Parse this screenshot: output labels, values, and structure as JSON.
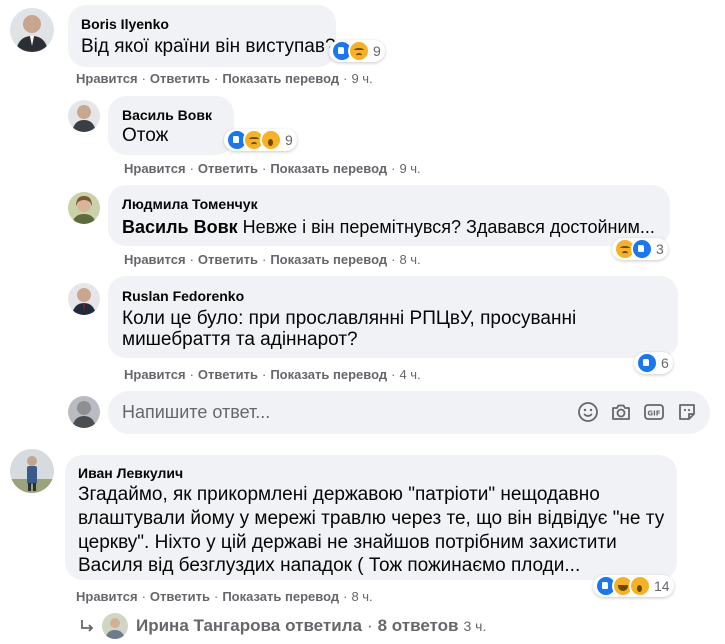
{
  "meta_actions": {
    "like": "Нравится",
    "reply": "Ответить",
    "translate": "Показать перевод",
    "dot": "·"
  },
  "comments": [
    {
      "author": "Boris Ilyenko",
      "text": "Від якої країни він виступав?",
      "count": "9",
      "time": "9 ч."
    },
    {
      "author": "Василь Вовк",
      "text": "Отож",
      "count": "9",
      "time": "9 ч."
    },
    {
      "author": "Людмила Томенчук",
      "mention": "Василь Вовк",
      "text": " Невже і він перемітнувся? Здавався достойним...",
      "count": "3",
      "time": "8 ч."
    },
    {
      "author": "Ruslan Fedorenko",
      "lines": [
        "Коли це було: при прославлянні РПЦвУ, просуванні",
        "мишебраття та адіннарот?"
      ],
      "count": "6",
      "time": "4 ч."
    },
    {
      "author": "Иван Левкулич",
      "lines": [
        "Згадаймо, як прикормлені державою \"патріоти\" нещодавно",
        "влаштували йому у мережі травлю через те, що він відвідує \"не ту",
        "церкву\". Ніхто у цій державі не знайшов потрібним захистити",
        "Василя від безглуздих нападок ( Тож пожинаємо плоди..."
      ],
      "count": "14",
      "time": "8 ч."
    }
  ],
  "composer": {
    "placeholder": "Напишите ответ..."
  },
  "replies": {
    "author": "Ирина Тангарова",
    "verb": "ответила",
    "dot": "·",
    "count_label": "8 ответов",
    "time": "3 ч."
  },
  "colors": {
    "bubble": "#f0f2f5",
    "meta_text": "#65676b",
    "like_blue": "#1877f2",
    "emoji_yellow": "#f7b125"
  }
}
